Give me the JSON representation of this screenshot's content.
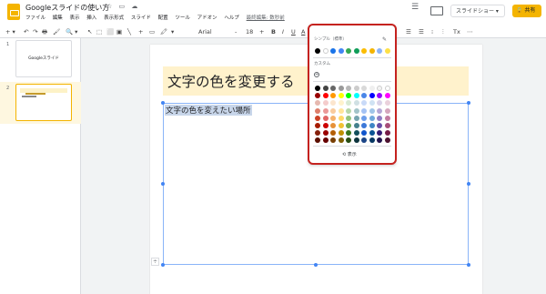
{
  "app": {
    "title": "Googleスライドの使い方",
    "title_icons": [
      "star-icon",
      "folder-icon",
      "cloud-icon"
    ],
    "title_icon_glyphs": [
      "☆",
      "▭",
      "☁"
    ]
  },
  "menu": {
    "items": [
      "ファイル",
      "編集",
      "表示",
      "挿入",
      "表示形式",
      "スライド",
      "配置",
      "ツール",
      "アドオン",
      "ヘルプ"
    ],
    "last_edit": "最終編集: 数秒前"
  },
  "header": {
    "comment_glyph": "☰",
    "present_label": "スライドショー ▾",
    "share_label": "🔒 共有"
  },
  "toolbar": {
    "glyphs": [
      "+ ▾",
      "↶",
      "↷",
      "🖶",
      "🖌",
      "🔍 ▾",
      "↖",
      "⬚",
      "⬜",
      "▣",
      "╲",
      "+",
      "▭",
      "🖍",
      "▾",
      "Arial",
      "-",
      "18",
      "+",
      "B",
      "I",
      "U",
      "A",
      "🖊",
      "⊖",
      "▣",
      "☰",
      "⁝▾",
      "☰",
      "☰",
      "⁝",
      "⫶",
      "Tx",
      "⋯"
    ]
  },
  "filmstrip": {
    "slides": [
      {
        "num": "1",
        "title": "Googleスライド"
      },
      {
        "num": "2",
        "title": ""
      }
    ]
  },
  "slide": {
    "title": "文字の色を変更する",
    "body": "文字の色を変えたい場所"
  },
  "palette": {
    "custom_label": "カスタム",
    "standard_label": "シンプル（標準）",
    "reset_label": "⟲ 表示",
    "accent_colors": [
      "#000000",
      "#ffffff",
      "#1a73e8",
      "#4285f4",
      "#34a853",
      "#0f9d58",
      "#fbbc04",
      "#f4b400",
      "#8ab4f8",
      "#fde047"
    ],
    "grid_colors": [
      [
        "#000000",
        "#434343",
        "#666666",
        "#999999",
        "#b7b7b7",
        "#cccccc",
        "#d9d9d9",
        "#efefef",
        "#f3f3f3",
        "#ffffff"
      ],
      [
        "#980000",
        "#ff0000",
        "#ff9900",
        "#ffff00",
        "#00ff00",
        "#00ffff",
        "#4a86e8",
        "#0000ff",
        "#9900ff",
        "#ff00ff"
      ],
      [
        "#e6b8af",
        "#f4cccc",
        "#fce5cd",
        "#fff2cc",
        "#d9ead3",
        "#d0e0e3",
        "#c9daf8",
        "#cfe2f3",
        "#d9d2e9",
        "#ead1dc"
      ],
      [
        "#dd7e6b",
        "#ea9999",
        "#f9cb9c",
        "#ffe599",
        "#b6d7a8",
        "#a2c4c9",
        "#a4c2f4",
        "#9fc5e8",
        "#b4a7d6",
        "#d5a6bd"
      ],
      [
        "#cc4125",
        "#e06666",
        "#f6b26b",
        "#ffd966",
        "#93c47d",
        "#76a5af",
        "#6d9eeb",
        "#6fa8dc",
        "#8e7cc3",
        "#c27ba0"
      ],
      [
        "#a61c00",
        "#cc0000",
        "#e69138",
        "#f1c232",
        "#6aa84f",
        "#45818e",
        "#3c78d8",
        "#3d85c6",
        "#674ea7",
        "#a64d79"
      ],
      [
        "#85200c",
        "#990000",
        "#b45f06",
        "#bf9000",
        "#38761d",
        "#134f5c",
        "#1155cc",
        "#0b5394",
        "#351c75",
        "#741b47"
      ],
      [
        "#5b0f00",
        "#660000",
        "#783f04",
        "#7f6000",
        "#274e13",
        "#0c343d",
        "#1c4587",
        "#073763",
        "#20124d",
        "#4c1130"
      ]
    ]
  }
}
